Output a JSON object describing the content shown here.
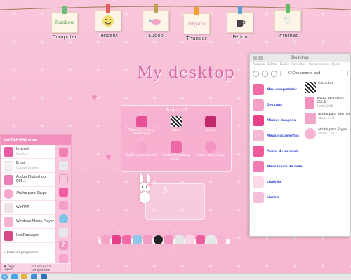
{
  "desktop": {
    "title": "My desktop",
    "hanging_icons": [
      {
        "label": "Computer",
        "card_text": "Rainbow",
        "peg": "#69c07a"
      },
      {
        "label": "Tencent",
        "card_text": "",
        "peg": "#e85c5c"
      },
      {
        "label": "Kugoo",
        "card_text": "",
        "peg": "#b8a24f"
      },
      {
        "label": "Thunder",
        "card_text": "Airplane",
        "peg": "#f0a030"
      },
      {
        "label": "Fetion",
        "card_text": "",
        "peg": "#5a9fd0"
      },
      {
        "label": "Internet",
        "card_text": "",
        "peg": "#5cbf5c"
      }
    ]
  },
  "project_window": {
    "title": "Projeto 2",
    "items": [
      {
        "label": "Tutorial 3 Glossy Photoshop"
      },
      {
        "label": "Zebra"
      },
      {
        "label": "Livros"
      },
      {
        "label": "Atalho para Internet"
      },
      {
        "label": "Adobe Photoshop CS5.1"
      },
      {
        "label": "Atalho para Skype"
      }
    ]
  },
  "explorer": {
    "title": "Desktop",
    "menu": [
      "Arquivo",
      "Editar",
      "Exibir",
      "Favoritos",
      "Ferramentas",
      "Ajuda"
    ],
    "address": "C:\\Documents and",
    "nav": [
      {
        "label": "Meu computador"
      },
      {
        "label": "Desktop"
      },
      {
        "label": "Minhas imagens"
      },
      {
        "label": "Meus documentos"
      },
      {
        "label": "Painel de controle"
      },
      {
        "label": "Meus locais de rede"
      },
      {
        "label": "Lixeirão"
      },
      {
        "label": "Lixeira"
      }
    ],
    "files": [
      {
        "name": "Coisinhas",
        "size": ""
      },
      {
        "name": "Adobe Photoshop CS5.1",
        "size": "Atalho 2 KB"
      },
      {
        "name": "Atalho para Internet",
        "size": "Atalho 2 KB"
      },
      {
        "name": "Atalho para Skype",
        "size": "Atalho 2 KB"
      }
    ]
  },
  "start_menu": {
    "user": "letf4899Love",
    "items": [
      {
        "name": "Internet",
        "sub": "Mozilla F..."
      },
      {
        "name": "Email",
        "sub": "Outlook Express"
      },
      {
        "name": "Adobe Photoshop CS5.1",
        "sub": ""
      },
      {
        "name": "Atalho para Skype",
        "sub": ""
      },
      {
        "name": "WinRAR",
        "sub": ""
      },
      {
        "name": "Windows Media Player",
        "sub": ""
      },
      {
        "name": "IconPackager",
        "sub": ""
      }
    ],
    "all_programs": "Todos os programas",
    "logoff": "Fazer logoff",
    "shutdown": "Desligar o computador"
  },
  "calendar": {
    "day": "5"
  },
  "colors": {
    "accent": "#f48fbd",
    "title": "#d96aa6",
    "nav_link": "#3a4fd6"
  }
}
